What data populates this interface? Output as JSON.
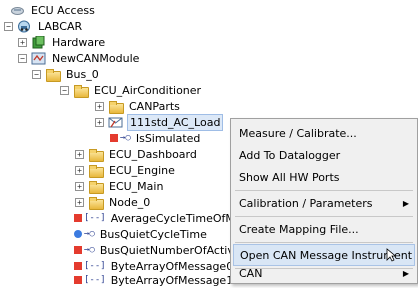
{
  "tree": [
    {
      "id": "ecu-access",
      "label": "ECU Access",
      "icon": "ecu-access-icon"
    },
    {
      "id": "labcar",
      "label": "LABCAR",
      "icon": "labcar-icon",
      "expander": "⊟"
    },
    {
      "id": "hardware",
      "label": "Hardware",
      "icon": "hardware-icon",
      "expander": "+"
    },
    {
      "id": "newcanmodule",
      "label": "NewCANModule",
      "icon": "can-module-icon",
      "expander": "−"
    },
    {
      "id": "bus0",
      "label": "Bus_0",
      "icon": "folder-icon",
      "expander": "−"
    },
    {
      "id": "ecu-aircon",
      "label": "ECU_AirConditioner",
      "icon": "folder-icon",
      "expander": "−"
    },
    {
      "id": "canparts",
      "label": "CANParts",
      "icon": "folder-icon",
      "expander": "+"
    },
    {
      "id": "acload",
      "label": "111std_AC_Load",
      "icon": "can-message-icon",
      "expander": "+"
    },
    {
      "id": "issimulated",
      "label": "IsSimulated",
      "icon": "signal-icon"
    },
    {
      "id": "ecu-dashboard",
      "label": "ECU_Dashboard",
      "icon": "folder-icon",
      "expander": "+"
    },
    {
      "id": "ecu-engine",
      "label": "ECU_Engine",
      "icon": "folder-icon",
      "expander": "+"
    },
    {
      "id": "ecu-main",
      "label": "ECU_Main",
      "icon": "folder-icon",
      "expander": "+"
    },
    {
      "id": "node0",
      "label": "Node_0",
      "icon": "folder-icon",
      "expander": "+"
    },
    {
      "id": "avgcycle",
      "label": "AverageCycleTimeOfMes",
      "icon": "signal-icon"
    },
    {
      "id": "busquiet",
      "label": "BusQuietCycleTime",
      "icon": "signal-icon"
    },
    {
      "id": "busquietnum",
      "label": "BusQuietNumberOfActiv",
      "icon": "signal-icon"
    },
    {
      "id": "bytearr0",
      "label": "ByteArrayOfMessage0",
      "icon": "signal-icon"
    },
    {
      "id": "bytearr1",
      "label": "ByteArrayOfMessage1",
      "icon": "signal-icon"
    }
  ],
  "menu": {
    "items": [
      {
        "label": "Measure / Calibrate..."
      },
      {
        "label": "Add To Datalogger"
      },
      {
        "label": "Show All HW Ports"
      },
      {
        "label": "Calibration / Parameters",
        "submenu": "▶"
      },
      {
        "label": "Create Mapping File..."
      },
      {
        "label": "Open CAN Message Instrument"
      },
      {
        "label": "CAN",
        "submenu": "▶"
      }
    ]
  },
  "glyphs": {
    "plus": "+",
    "minus": "−",
    "signal_bracket": "[--]",
    "signal_arrow": "→○"
  },
  "colors": {
    "selection": "#dce8f7",
    "menu_bg": "#f0f0f0",
    "signal_red": "#e43b2e",
    "signal_blue": "#3b7be0"
  }
}
